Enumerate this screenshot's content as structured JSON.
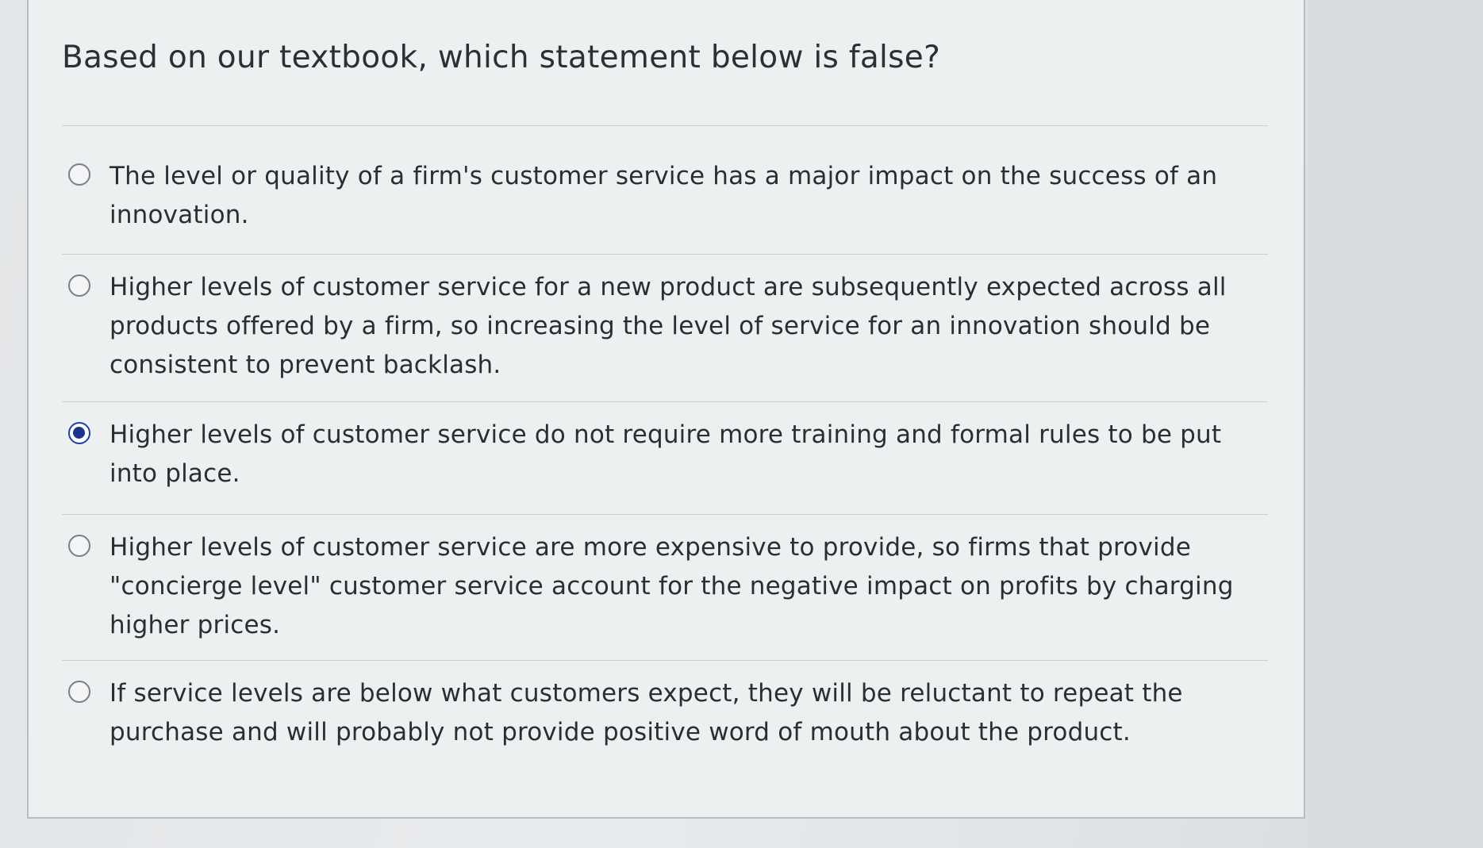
{
  "question": {
    "text": "Based on our textbook, which statement below is false?"
  },
  "options": [
    {
      "label": "The level or quality of a firm's customer service has a major impact on the success of an innovation.",
      "selected": false
    },
    {
      "label": "Higher levels of customer service for a new product are subsequently expected across all products offered by a firm, so increasing the level of service for an innovation should be consistent to prevent backlash.",
      "selected": false
    },
    {
      "label": "Higher levels of customer service do not require more training and formal rules to be put into place.",
      "selected": true
    },
    {
      "label": "Higher levels of customer service are more expensive to provide, so firms that provide \"concierge level\" customer service account for the negative impact on profits by charging higher prices.",
      "selected": false
    },
    {
      "label": "If service levels are below what customers expect, they will be reluctant to repeat the purchase and will probably not provide positive word of mouth about the product.",
      "selected": false
    }
  ],
  "colors": {
    "radio_selected": "#1d3494",
    "card_background": "#edf0f1"
  }
}
